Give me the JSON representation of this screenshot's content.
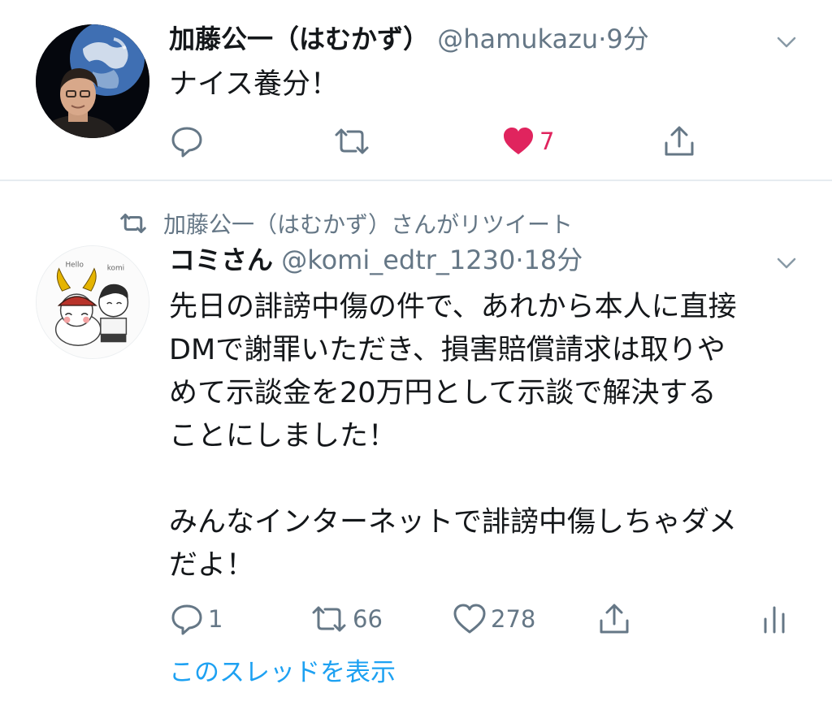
{
  "tweets": [
    {
      "display_name": "加藤公一（はむかず）",
      "handle": "@hamukazu",
      "separator": "·",
      "time": "9分",
      "text": "ナイス養分！",
      "actions": {
        "reply_count": "",
        "retweet_count": "",
        "like_count": "7",
        "liked": true
      }
    },
    {
      "retweet_context": "加藤公一（はむかず）さんがリツイート",
      "display_name": "コミさん",
      "handle": "@komi_edtr_1230",
      "separator": "·",
      "time": "18分",
      "text": "先日の誹謗中傷の件で、あれから本人に直接\nDMで謝罪いただき、損害賠償請求は取りや\nめて示談金を20万円として示談で解決する\nことにしました！\n\nみんなインターネットで誹謗中傷しちゃダメ\nだよ！",
      "actions": {
        "reply_count": "1",
        "retweet_count": "66",
        "like_count": "278"
      },
      "thread_link": "このスレッドを表示"
    }
  ],
  "colors": {
    "text": "#14171a",
    "secondary": "#657786",
    "like": "#e0245e",
    "link": "#1da1f2",
    "divider": "#e6ecf0"
  },
  "icons": [
    "reply-icon",
    "retweet-icon",
    "like-icon",
    "share-icon",
    "analytics-icon",
    "chevron-down-icon"
  ]
}
